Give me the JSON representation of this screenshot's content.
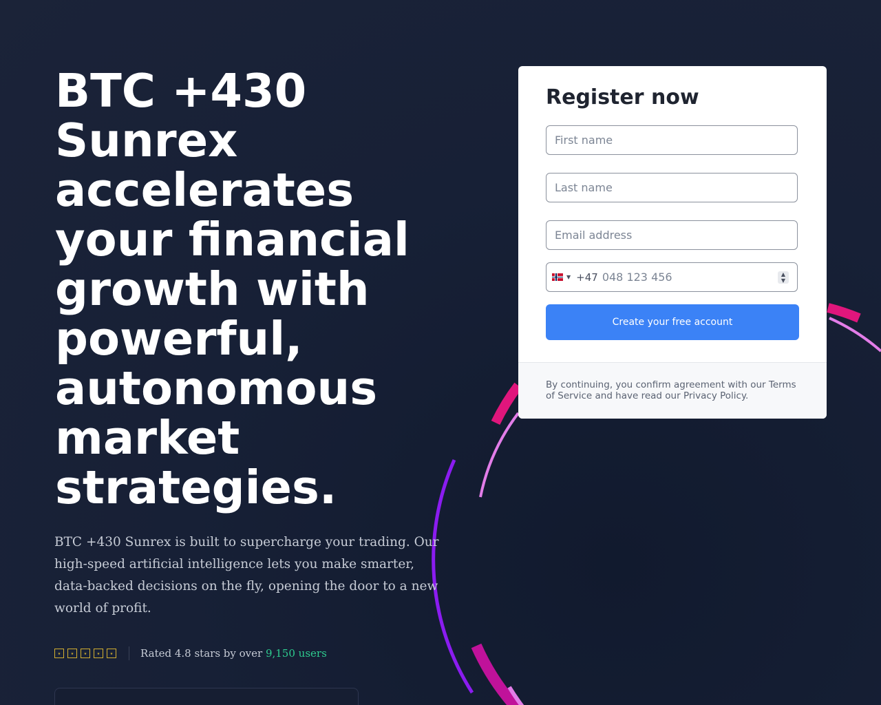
{
  "hero": {
    "headline": "BTC +430 Sunrex accelerates your financial growth with powerful, autonomous market strategies.",
    "description": "BTC +430 Sunrex is built to supercharge your trading. Our high-speed artificial intelligence lets you make smarter, data-backed decisions on the fly, opening the door to a new world of profit.",
    "rating": {
      "stars": [
        "star-icon",
        "star-icon",
        "star-icon",
        "star-icon",
        "star-icon"
      ],
      "text_prefix": "Rated 4.8 stars by over ",
      "users": "9,150 users"
    }
  },
  "form": {
    "title": "Register now",
    "first_name_placeholder": "First name",
    "last_name_placeholder": "Last name",
    "email_placeholder": "Email address",
    "phone": {
      "flag_icon": "norway-flag-icon",
      "dial_code": "+47",
      "placeholder": "048 123 456"
    },
    "submit_label": "Create your free account",
    "legal": "By continuing, you confirm agreement with our Terms of Service and have read our Privacy Policy."
  },
  "colors": {
    "background": "#182038",
    "accent": "#3b82f6",
    "highlight_green": "#2ecc8f",
    "arc_pink": "#e0167c",
    "arc_violet": "#8b1cf0",
    "arc_light": "#e27de8"
  }
}
